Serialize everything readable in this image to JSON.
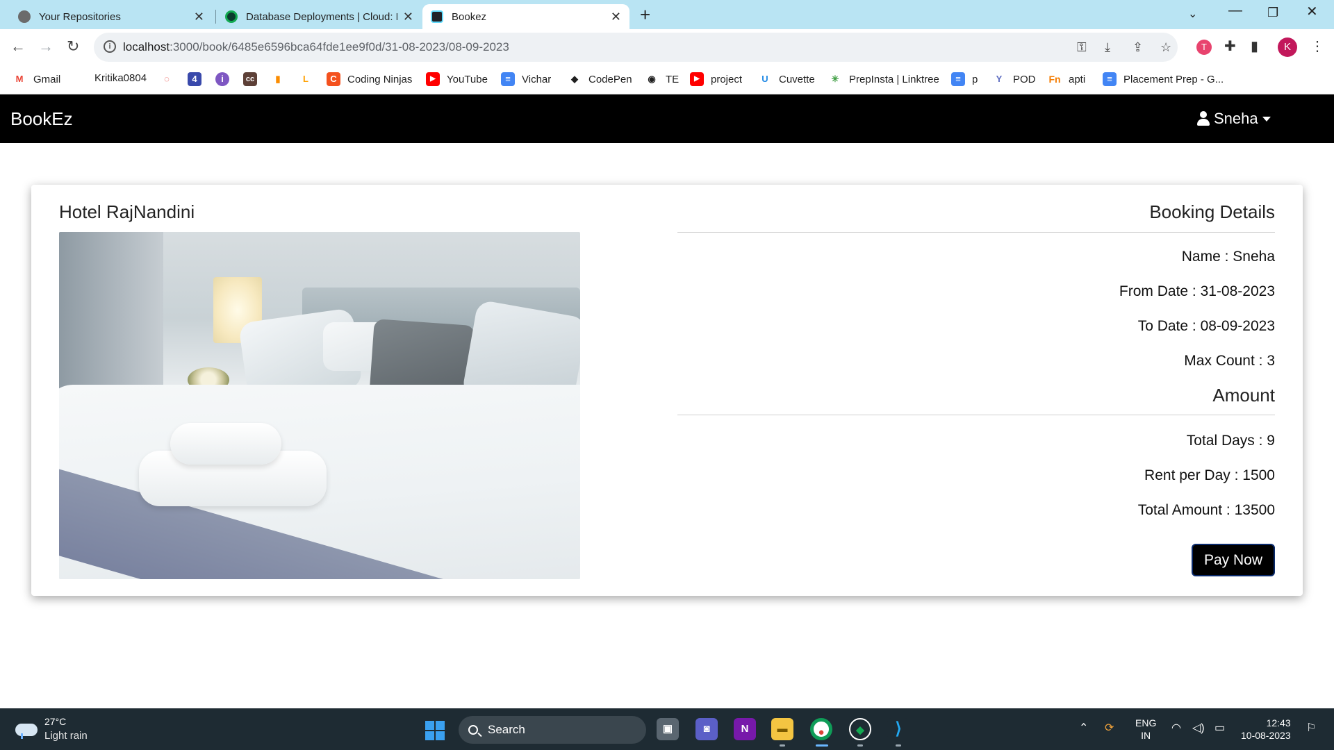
{
  "browser": {
    "tabs": [
      {
        "title": "Your Repositories",
        "active": false
      },
      {
        "title": "Database Deployments | Cloud: M",
        "active": false
      },
      {
        "title": "Bookez",
        "active": true
      }
    ],
    "url_host": "localhost",
    "url_rest": ":3000/book/6485e6596bca64fde1ee9f0d/31-08-2023/08-09-2023",
    "profile_initial": "K",
    "bookmarks": [
      {
        "label": "Gmail",
        "icon": "gmail-icon",
        "color": "#EA4335",
        "glyph": "M"
      },
      {
        "label": "Kritika0804",
        "icon": "blank-icon",
        "color": "#ffffff",
        "glyph": ""
      },
      {
        "label": "",
        "icon": "chat-icon",
        "color": "#E53935",
        "glyph": "◌"
      },
      {
        "label": "",
        "icon": "badge-440-icon",
        "color": "#3949AB",
        "glyph": "4"
      },
      {
        "label": "",
        "icon": "circle-i-icon",
        "color": "#7E57C2",
        "glyph": "i"
      },
      {
        "label": "",
        "icon": "cc-icon",
        "color": "#5D4037",
        "glyph": "cc"
      },
      {
        "label": "",
        "icon": "bar-chart-icon",
        "color": "#FB8C00",
        "glyph": "▮"
      },
      {
        "label": "",
        "icon": "leetcode-icon",
        "color": "#FFA000",
        "glyph": "L"
      },
      {
        "label": "Coding Ninjas",
        "icon": "coding-ninjas-icon",
        "color": "#F4511E",
        "glyph": "C"
      },
      {
        "label": "YouTube",
        "icon": "youtube-icon",
        "color": "#FF0000",
        "glyph": "▶"
      },
      {
        "label": "Vichar",
        "icon": "doc-icon",
        "color": "#4285F4",
        "glyph": "≡"
      },
      {
        "label": "CodePen",
        "icon": "codepen-icon",
        "color": "#1f1f1f",
        "glyph": "◆"
      },
      {
        "label": "TE",
        "icon": "globe-icon",
        "color": "#1f1f1f",
        "glyph": "◉"
      },
      {
        "label": "project",
        "icon": "youtube-icon",
        "color": "#FF0000",
        "glyph": "▶"
      },
      {
        "label": "Cuvette",
        "icon": "cuvette-icon",
        "color": "#1E88E5",
        "glyph": "U"
      },
      {
        "label": "PrepInsta | Linktree",
        "icon": "linktree-icon",
        "color": "#43A047",
        "glyph": "✳"
      },
      {
        "label": "p",
        "icon": "doc-icon",
        "color": "#4285F4",
        "glyph": "≡"
      },
      {
        "label": "POD",
        "icon": "pod-icon",
        "color": "#5C6BC0",
        "glyph": "Y"
      },
      {
        "label": "apti",
        "icon": "fn-icon",
        "color": "#F57C00",
        "glyph": "Fn"
      },
      {
        "label": "Placement Prep - G...",
        "icon": "doc-icon",
        "color": "#4285F4",
        "glyph": "≡"
      }
    ]
  },
  "app": {
    "brand": "BookEz",
    "user_name": "Sneha"
  },
  "booking": {
    "hotel_name": "Hotel RajNandini",
    "details_title": "Booking Details",
    "name": "Name : Sneha",
    "from_date": "From Date : 31-08-2023",
    "to_date": "To Date : 08-09-2023",
    "max_count": "Max Count : 3",
    "amount_title": "Amount",
    "total_days": "Total Days : 9",
    "rent_per_day": "Rent per Day : 1500",
    "total_amount": "Total Amount : 13500",
    "pay_label": "Pay Now"
  },
  "taskbar": {
    "temperature": "27°C",
    "condition": "Light rain",
    "search_label": "Search",
    "lang_1": "ENG",
    "lang_2": "IN",
    "time": "12:43",
    "date": "10-08-2023"
  }
}
